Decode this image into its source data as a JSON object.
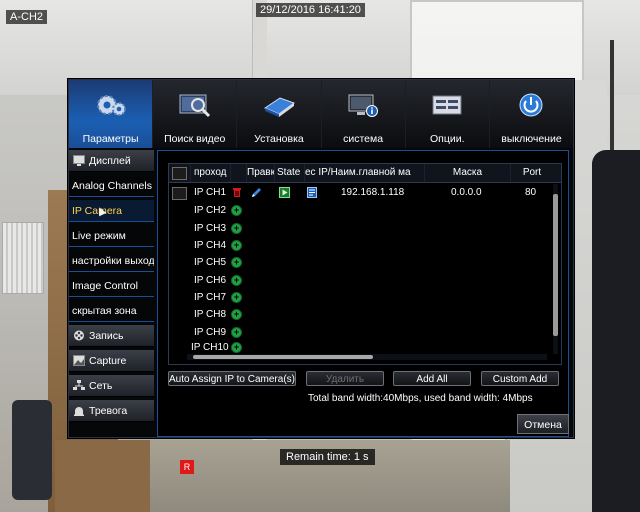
{
  "osd": {
    "channel": "A-CH2",
    "datetime": "29/12/2016 16:41:20",
    "rec_badge": "R",
    "remain": "Remain time: 1 s"
  },
  "nav": [
    {
      "label": "Параметры",
      "icon": "gears-icon"
    },
    {
      "label": "Поиск видео",
      "icon": "video-search-icon"
    },
    {
      "label": "Установка",
      "icon": "install-book-icon"
    },
    {
      "label": "система",
      "icon": "system-info-icon"
    },
    {
      "label": "Опции.",
      "icon": "options-panel-icon"
    },
    {
      "label": "выключение",
      "icon": "power-icon"
    }
  ],
  "sidebar": {
    "display": "Дисплей",
    "analog": "Analog Channels",
    "ipcamera": "IP Camera",
    "live": "Live режим",
    "output": "настройки выхода",
    "image": "Image Control",
    "privacy": "скрытая зона",
    "record": "Запись",
    "capture": "Capture",
    "network": "Сеть",
    "alarm": "Тревога"
  },
  "table": {
    "headers": {
      "channel": "проход",
      "edit": "Правка",
      "state": "State",
      "address": "ес IP/Наим.главной ма",
      "mask": "Маска",
      "port": "Port"
    },
    "rows": [
      {
        "channel": "IP CH1",
        "address": "192.168.1.118",
        "mask": "0.0.0.0",
        "port": "80"
      },
      {
        "channel": "IP CH2"
      },
      {
        "channel": "IP CH3"
      },
      {
        "channel": "IP CH4"
      },
      {
        "channel": "IP CH5"
      },
      {
        "channel": "IP CH6"
      },
      {
        "channel": "IP CH7"
      },
      {
        "channel": "IP CH8"
      },
      {
        "channel": "IP CH9"
      },
      {
        "channel": "IP CH10"
      }
    ],
    "add_symbol": "+"
  },
  "buttons": {
    "auto_assign": "Auto Assign IP to Camera(s)",
    "delete": "Удалить",
    "add_all": "Add All",
    "custom_add": "Custom Add",
    "cancel": "Отмена"
  },
  "bandwidth": "Total band width:40Mbps, used band width: 4Mbps",
  "colors": {
    "active_nav": "#1b5fb3",
    "selected_item_text": "#ffd24a",
    "add_green": "#23a045",
    "delete_red": "#d11b1b"
  }
}
